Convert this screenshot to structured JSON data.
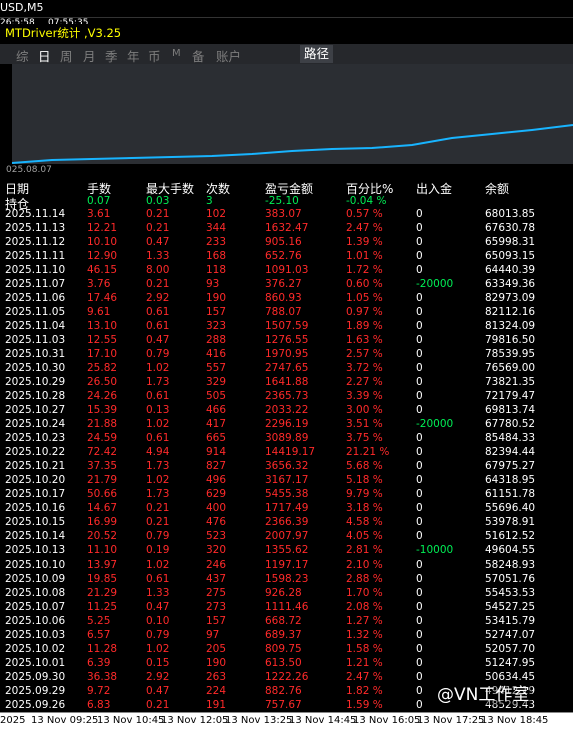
{
  "window": {
    "symbol": "USD,M5",
    "time_left": "26:5:58",
    "time_right": "07:55:35"
  },
  "ea": {
    "name": "MTDriver统计 ,V3.25"
  },
  "tabs": [
    {
      "label": "综"
    },
    {
      "label": "日"
    },
    {
      "label": "周"
    },
    {
      "label": "月"
    },
    {
      "label": "季"
    },
    {
      "label": "年"
    },
    {
      "label": "币"
    },
    {
      "label": "M"
    },
    {
      "label": "备"
    },
    {
      "label": "账户"
    },
    {
      "label": "路径"
    }
  ],
  "chart": {
    "start_date": "025.08.07",
    "line_color": "#18b4ff"
  },
  "headers": {
    "date": "日期",
    "lots": "手数",
    "max_lots": "最大手数",
    "count": "次数",
    "pnl": "盈亏金额",
    "pct": "百分比%",
    "deposit": "出入金",
    "balance": "余额"
  },
  "holding": {
    "date": "持仓",
    "lots": "0.07",
    "max_lots": "0.03",
    "count": "3",
    "pnl": "-25.10",
    "pct": "-0.04 %",
    "deposit": "",
    "balance": ""
  },
  "rows": [
    {
      "date": "2025.11.14",
      "lots": "3.61",
      "max": "0.21",
      "count": "102",
      "pnl": "383.07",
      "pct": "0.57 %",
      "dep": "0",
      "bal": "68013.85"
    },
    {
      "date": "2025.11.13",
      "lots": "12.21",
      "max": "0.21",
      "count": "344",
      "pnl": "1632.47",
      "pct": "2.47 %",
      "dep": "0",
      "bal": "67630.78"
    },
    {
      "date": "2025.11.12",
      "lots": "10.10",
      "max": "0.47",
      "count": "233",
      "pnl": "905.16",
      "pct": "1.39 %",
      "dep": "0",
      "bal": "65998.31"
    },
    {
      "date": "2025.11.11",
      "lots": "12.90",
      "max": "1.33",
      "count": "168",
      "pnl": "652.76",
      "pct": "1.01 %",
      "dep": "0",
      "bal": "65093.15"
    },
    {
      "date": "2025.11.10",
      "lots": "46.15",
      "max": "8.00",
      "count": "118",
      "pnl": "1091.03",
      "pct": "1.72 %",
      "dep": "0",
      "bal": "64440.39"
    },
    {
      "date": "2025.11.07",
      "lots": "3.76",
      "max": "0.21",
      "count": "93",
      "pnl": "376.27",
      "pct": "0.60 %",
      "dep": "-20000",
      "bal": "63349.36"
    },
    {
      "date": "2025.11.06",
      "lots": "17.46",
      "max": "2.92",
      "count": "190",
      "pnl": "860.93",
      "pct": "1.05 %",
      "dep": "0",
      "bal": "82973.09"
    },
    {
      "date": "2025.11.05",
      "lots": "9.61",
      "max": "0.61",
      "count": "157",
      "pnl": "788.07",
      "pct": "0.97 %",
      "dep": "0",
      "bal": "82112.16"
    },
    {
      "date": "2025.11.04",
      "lots": "13.10",
      "max": "0.61",
      "count": "323",
      "pnl": "1507.59",
      "pct": "1.89 %",
      "dep": "0",
      "bal": "81324.09"
    },
    {
      "date": "2025.11.03",
      "lots": "12.55",
      "max": "0.47",
      "count": "288",
      "pnl": "1276.55",
      "pct": "1.63 %",
      "dep": "0",
      "bal": "79816.50"
    },
    {
      "date": "2025.10.31",
      "lots": "17.10",
      "max": "0.79",
      "count": "416",
      "pnl": "1970.95",
      "pct": "2.57 %",
      "dep": "0",
      "bal": "78539.95"
    },
    {
      "date": "2025.10.30",
      "lots": "25.82",
      "max": "1.02",
      "count": "557",
      "pnl": "2747.65",
      "pct": "3.72 %",
      "dep": "0",
      "bal": "76569.00"
    },
    {
      "date": "2025.10.29",
      "lots": "26.50",
      "max": "1.73",
      "count": "329",
      "pnl": "1641.88",
      "pct": "2.27 %",
      "dep": "0",
      "bal": "73821.35"
    },
    {
      "date": "2025.10.28",
      "lots": "24.26",
      "max": "0.61",
      "count": "505",
      "pnl": "2365.73",
      "pct": "3.39 %",
      "dep": "0",
      "bal": "72179.47"
    },
    {
      "date": "2025.10.27",
      "lots": "15.39",
      "max": "0.13",
      "count": "466",
      "pnl": "2033.22",
      "pct": "3.00 %",
      "dep": "0",
      "bal": "69813.74"
    },
    {
      "date": "2025.10.24",
      "lots": "21.88",
      "max": "1.02",
      "count": "417",
      "pnl": "2296.19",
      "pct": "3.51 %",
      "dep": "-20000",
      "bal": "67780.52"
    },
    {
      "date": "2025.10.23",
      "lots": "24.59",
      "max": "0.61",
      "count": "665",
      "pnl": "3089.89",
      "pct": "3.75 %",
      "dep": "0",
      "bal": "85484.33"
    },
    {
      "date": "2025.10.22",
      "lots": "72.42",
      "max": "4.94",
      "count": "914",
      "pnl": "14419.17",
      "pct": "21.21 %",
      "dep": "0",
      "bal": "82394.44"
    },
    {
      "date": "2025.10.21",
      "lots": "37.35",
      "max": "1.73",
      "count": "827",
      "pnl": "3656.32",
      "pct": "5.68 %",
      "dep": "0",
      "bal": "67975.27"
    },
    {
      "date": "2025.10.20",
      "lots": "21.79",
      "max": "1.02",
      "count": "496",
      "pnl": "3167.17",
      "pct": "5.18 %",
      "dep": "0",
      "bal": "64318.95"
    },
    {
      "date": "2025.10.17",
      "lots": "50.66",
      "max": "1.73",
      "count": "629",
      "pnl": "5455.38",
      "pct": "9.79 %",
      "dep": "0",
      "bal": "61151.78"
    },
    {
      "date": "2025.10.16",
      "lots": "14.67",
      "max": "0.21",
      "count": "400",
      "pnl": "1717.49",
      "pct": "3.18 %",
      "dep": "0",
      "bal": "55696.40"
    },
    {
      "date": "2025.10.15",
      "lots": "16.99",
      "max": "0.21",
      "count": "476",
      "pnl": "2366.39",
      "pct": "4.58 %",
      "dep": "0",
      "bal": "53978.91"
    },
    {
      "date": "2025.10.14",
      "lots": "20.52",
      "max": "0.79",
      "count": "523",
      "pnl": "2007.97",
      "pct": "4.05 %",
      "dep": "0",
      "bal": "51612.52"
    },
    {
      "date": "2025.10.13",
      "lots": "11.10",
      "max": "0.19",
      "count": "320",
      "pnl": "1355.62",
      "pct": "2.81 %",
      "dep": "-10000",
      "bal": "49604.55"
    },
    {
      "date": "2025.10.10",
      "lots": "13.97",
      "max": "1.02",
      "count": "246",
      "pnl": "1197.17",
      "pct": "2.10 %",
      "dep": "0",
      "bal": "58248.93"
    },
    {
      "date": "2025.10.09",
      "lots": "19.85",
      "max": "0.61",
      "count": "437",
      "pnl": "1598.23",
      "pct": "2.88 %",
      "dep": "0",
      "bal": "57051.76"
    },
    {
      "date": "2025.10.08",
      "lots": "21.29",
      "max": "1.33",
      "count": "275",
      "pnl": "926.28",
      "pct": "1.70 %",
      "dep": "0",
      "bal": "55453.53"
    },
    {
      "date": "2025.10.07",
      "lots": "11.25",
      "max": "0.47",
      "count": "273",
      "pnl": "1111.46",
      "pct": "2.08 %",
      "dep": "0",
      "bal": "54527.25"
    },
    {
      "date": "2025.10.06",
      "lots": "5.25",
      "max": "0.10",
      "count": "157",
      "pnl": "668.72",
      "pct": "1.27 %",
      "dep": "0",
      "bal": "53415.79"
    },
    {
      "date": "2025.10.03",
      "lots": "6.57",
      "max": "0.79",
      "count": "97",
      "pnl": "689.37",
      "pct": "1.32 %",
      "dep": "0",
      "bal": "52747.07"
    },
    {
      "date": "2025.10.02",
      "lots": "11.28",
      "max": "1.02",
      "count": "205",
      "pnl": "809.75",
      "pct": "1.58 %",
      "dep": "0",
      "bal": "52057.70"
    },
    {
      "date": "2025.10.01",
      "lots": "6.39",
      "max": "0.15",
      "count": "190",
      "pnl": "613.50",
      "pct": "1.21 %",
      "dep": "0",
      "bal": "51247.95"
    },
    {
      "date": "2025.09.30",
      "lots": "36.38",
      "max": "2.92",
      "count": "263",
      "pnl": "1222.26",
      "pct": "2.47 %",
      "dep": "0",
      "bal": "50634.45"
    },
    {
      "date": "2025.09.29",
      "lots": "9.72",
      "max": "0.47",
      "count": "224",
      "pnl": "882.76",
      "pct": "1.82 %",
      "dep": "0",
      "bal": "49412.19"
    },
    {
      "date": "2025.09.26",
      "lots": "6.83",
      "max": "0.21",
      "count": "191",
      "pnl": "757.67",
      "pct": "1.59 %",
      "dep": "0",
      "bal": "48529.43"
    }
  ],
  "axis": {
    "labels": [
      "2025",
      "13 Nov 09:25",
      "13 Nov 10:45",
      "13 Nov 12:05",
      "13 Nov 13:25",
      "13 Nov 14:45",
      "13 Nov 16:05",
      "13 Nov 17:25",
      "13 Nov 18:45"
    ]
  },
  "watermark": {
    "text": "@VN工作室"
  }
}
